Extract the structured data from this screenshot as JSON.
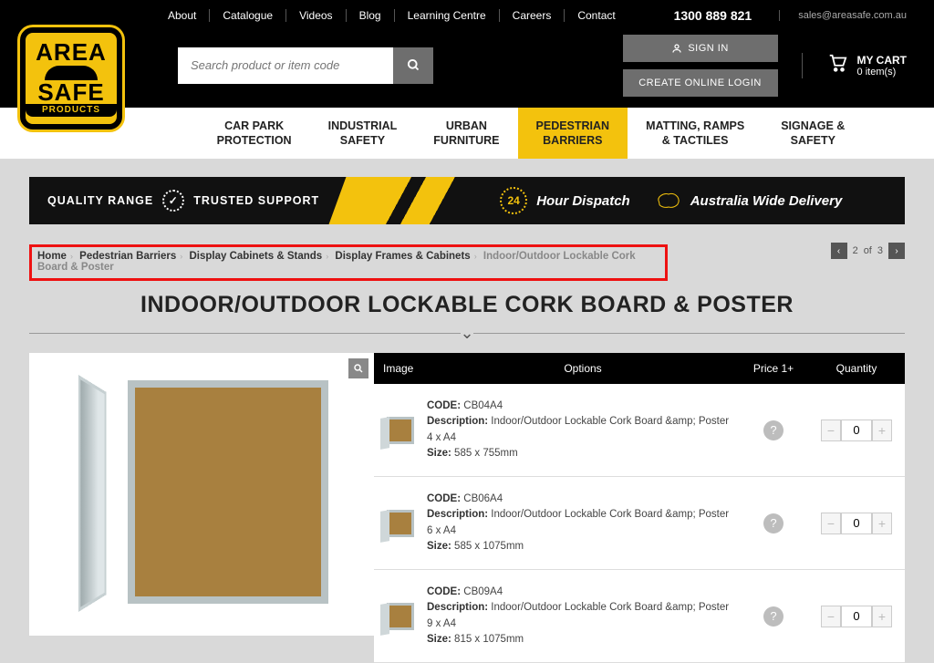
{
  "topnav": [
    "About",
    "Catalogue",
    "Videos",
    "Blog",
    "Learning Centre",
    "Careers",
    "Contact"
  ],
  "phone": "1300 889 821",
  "email": "sales@areasafe.com.au",
  "logo": {
    "l1": "AREA",
    "l2": "SAFE",
    "l3": "PRODUCTS"
  },
  "search": {
    "placeholder": "Search product or item code"
  },
  "signin": "SIGN IN",
  "create": "CREATE ONLINE LOGIN",
  "cart": {
    "label": "MY CART",
    "items": "0 item(s)"
  },
  "mainnav": [
    {
      "l1": "CAR PARK",
      "l2": "PROTECTION"
    },
    {
      "l1": "INDUSTRIAL",
      "l2": "SAFETY"
    },
    {
      "l1": "URBAN",
      "l2": "FURNITURE"
    },
    {
      "l1": "PEDESTRIAN",
      "l2": "BARRIERS",
      "active": true
    },
    {
      "l1": "MATTING, RAMPS",
      "l2": "& TACTILES"
    },
    {
      "l1": "SIGNAGE &",
      "l2": "SAFETY"
    }
  ],
  "banner": {
    "quality": "QUALITY RANGE",
    "trusted": "TRUSTED SUPPORT",
    "b24": "24",
    "dispatch": "Hour Dispatch",
    "aus": "Australia Wide Delivery"
  },
  "breadcrumb": [
    {
      "t": "Home"
    },
    {
      "t": "Pedestrian Barriers"
    },
    {
      "t": "Display Cabinets & Stands"
    },
    {
      "t": "Display Frames & Cabinets"
    },
    {
      "t": "Indoor/Outdoor Lockable Cork Board & Poster",
      "cur": true
    }
  ],
  "pager": {
    "pos": "2",
    "of": "of",
    "total": "3"
  },
  "title": "INDOOR/OUTDOOR LOCKABLE CORK BOARD & POSTER",
  "thead": {
    "img": "Image",
    "opt": "Options",
    "price": "Price 1+",
    "qty": "Quantity"
  },
  "labels": {
    "code": "CODE:",
    "desc": "Description:",
    "size": "Size:"
  },
  "rows": [
    {
      "code": "CB04A4",
      "desc": "Indoor/Outdoor Lockable Cork Board &amp; Poster 4 x A4",
      "size": "585 x 755mm",
      "qty": "0"
    },
    {
      "code": "CB06A4",
      "desc": "Indoor/Outdoor Lockable Cork Board &amp; Poster 6 x A4",
      "size": "585 x 1075mm",
      "qty": "0"
    },
    {
      "code": "CB09A4",
      "desc": "Indoor/Outdoor Lockable Cork Board &amp; Poster 9 x A4",
      "size": "815 x 1075mm",
      "qty": "0"
    }
  ]
}
